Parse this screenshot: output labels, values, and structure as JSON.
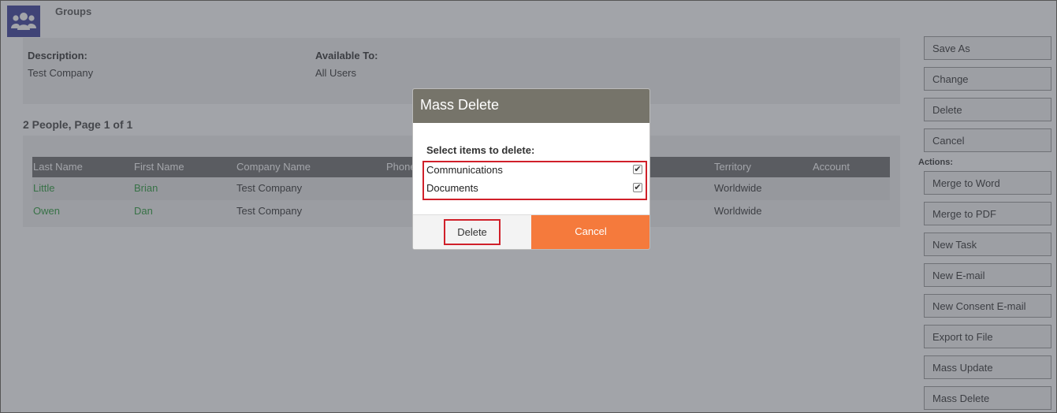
{
  "header": {
    "title": "Groups",
    "icon": "group-people-icon",
    "icon_bg": "#3b3f9a"
  },
  "info": {
    "description_label": "Description:",
    "description_value": "Test Company",
    "available_label": "Available To:",
    "available_value": "All Users"
  },
  "people_heading": "2 People, Page 1 of 1",
  "table": {
    "columns": [
      "Last Name",
      "First Name",
      "Company Name",
      "Phone",
      "Territory",
      "Account"
    ],
    "rows": [
      {
        "last": "Little",
        "first": "Brian",
        "company": "Test Company",
        "territory": "Worldwide"
      },
      {
        "last": "Owen",
        "first": "Dan",
        "company": "Test Company",
        "territory": "Worldwide"
      }
    ]
  },
  "sidebar": {
    "top_buttons": [
      "Save As",
      "Change",
      "Delete",
      "Cancel"
    ],
    "actions_label": "Actions:",
    "action_buttons": [
      "Merge to Word",
      "Merge to PDF",
      "New Task",
      "New E-mail",
      "New Consent E-mail",
      "Export to File",
      "Mass Update",
      "Mass Delete"
    ]
  },
  "modal": {
    "title": "Mass Delete",
    "subtitle": "Select items to delete:",
    "options": [
      {
        "label": "Communications",
        "checked": true
      },
      {
        "label": "Documents",
        "checked": true
      }
    ],
    "delete_label": "Delete",
    "cancel_label": "Cancel",
    "cancel_color": "#f57a3c",
    "header_color": "#76746a",
    "highlight_color": "#d0202a"
  }
}
